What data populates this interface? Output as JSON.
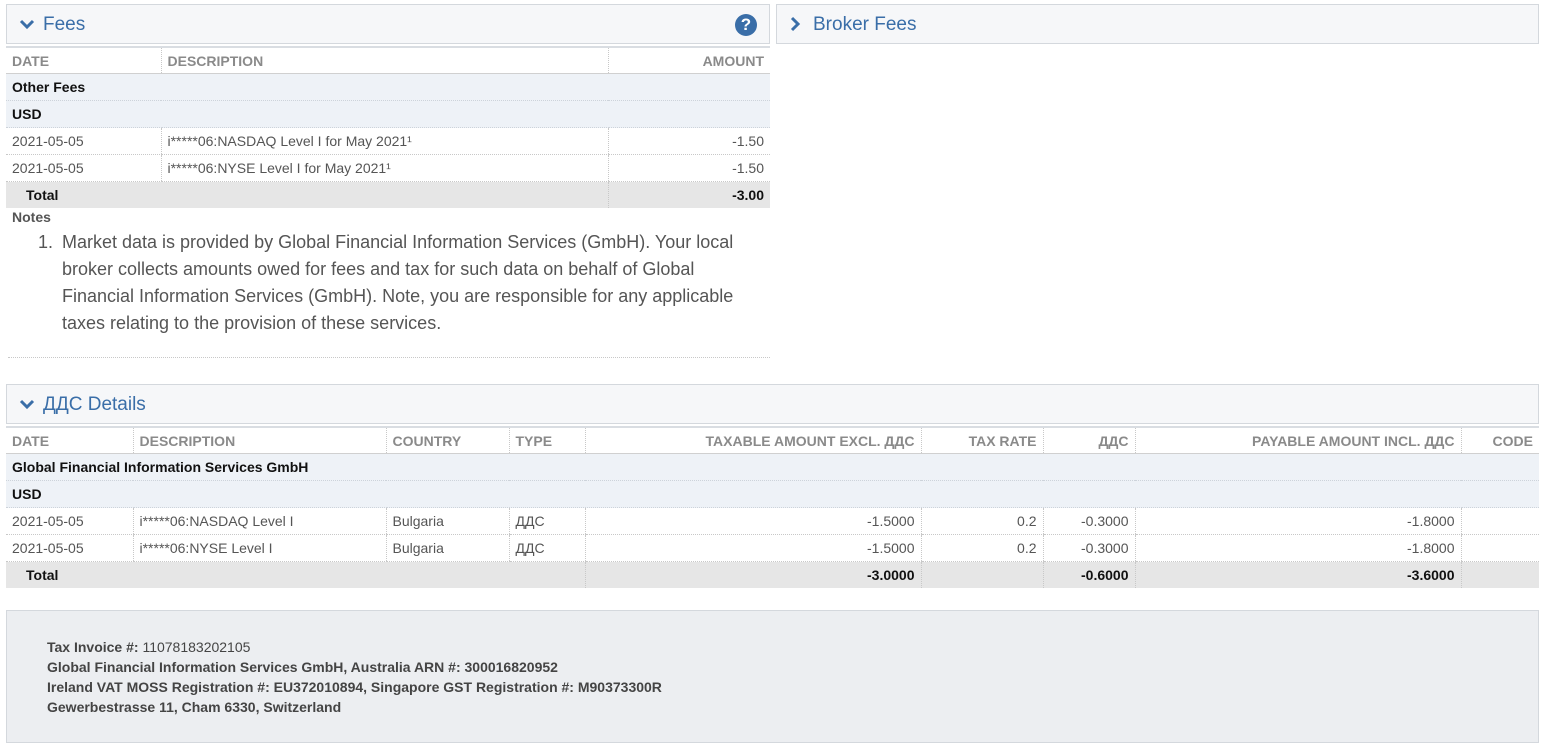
{
  "fees_panel": {
    "title": "Fees",
    "help_icon": "question-circle-icon",
    "columns": {
      "date": "DATE",
      "description": "DESCRIPTION",
      "amount": "AMOUNT"
    },
    "groups": {
      "category": "Other Fees",
      "currency": "USD"
    },
    "rows": [
      {
        "date": "2021-05-05",
        "description": "i*****06:NASDAQ Level I for May 2021¹",
        "amount": "-1.50"
      },
      {
        "date": "2021-05-05",
        "description": "i*****06:NYSE Level I for May 2021¹",
        "amount": "-1.50"
      }
    ],
    "total": {
      "label": "Total",
      "amount": "-3.00"
    },
    "notes_label": "Notes",
    "notes": [
      {
        "num": "1.",
        "text": "Market data is provided by Global Financial Information Services (GmbH). Your local broker collects amounts owed for fees and tax for such data on behalf of Global Financial Information Services (GmbH). Note, you are responsible for any applicable taxes relating to the provision of these services."
      }
    ]
  },
  "broker_fees_panel": {
    "title": "Broker Fees"
  },
  "vat_panel": {
    "title": "ДДС Details",
    "columns": {
      "date": "DATE",
      "description": "DESCRIPTION",
      "country": "COUNTRY",
      "type": "TYPE",
      "taxable": "TAXABLE AMOUNT EXCL. ДДС",
      "rate": "TAX RATE",
      "vat": "ДДС",
      "payable": "PAYABLE AMOUNT INCL. ДДС",
      "code": "CODE"
    },
    "groups": {
      "entity": "Global Financial Information Services GmbH",
      "currency": "USD"
    },
    "rows": [
      {
        "date": "2021-05-05",
        "description": "i*****06:NASDAQ Level I",
        "country": "Bulgaria",
        "type": "ДДС",
        "taxable": "-1.5000",
        "rate": "0.2",
        "vat": "-0.3000",
        "payable": "-1.8000",
        "code": ""
      },
      {
        "date": "2021-05-05",
        "description": "i*****06:NYSE Level I",
        "country": "Bulgaria",
        "type": "ДДС",
        "taxable": "-1.5000",
        "rate": "0.2",
        "vat": "-0.3000",
        "payable": "-1.8000",
        "code": ""
      }
    ],
    "total": {
      "label": "Total",
      "taxable": "-3.0000",
      "vat": "-0.6000",
      "payable": "-3.6000"
    }
  },
  "footer": {
    "invoice_label": "Tax Invoice #:",
    "invoice_number": "11078183202105",
    "line2": "Global Financial Information Services GmbH, Australia ARN #: 300016820952",
    "line3": "Ireland VAT MOSS Registration #: EU372010894, Singapore GST Registration #: M90373300R",
    "line4": "Gewerbestrasse 11, Cham 6330, Switzerland"
  }
}
